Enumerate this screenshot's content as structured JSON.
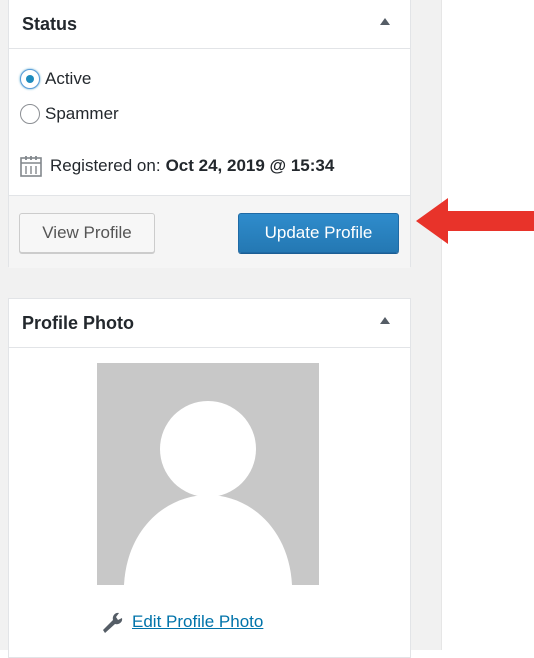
{
  "status_box": {
    "title": "Status",
    "options": [
      {
        "label": "Active",
        "checked": true
      },
      {
        "label": "Spammer",
        "checked": false
      }
    ],
    "registered_label": "Registered on:",
    "registered_date": "Oct 24, 2019 @ 15:34",
    "view_button": "View Profile",
    "update_button": "Update Profile"
  },
  "photo_box": {
    "title": "Profile Photo",
    "edit_link": "Edit Profile Photo"
  },
  "colors": {
    "primary_button": "#2e86c1",
    "link": "#0073aa",
    "arrow": "#e8332a",
    "radio_dot": "#1e8cbe"
  },
  "icons": [
    "calendar-icon",
    "wrench-icon",
    "collapse-arrow-icon",
    "annotation-arrow"
  ]
}
